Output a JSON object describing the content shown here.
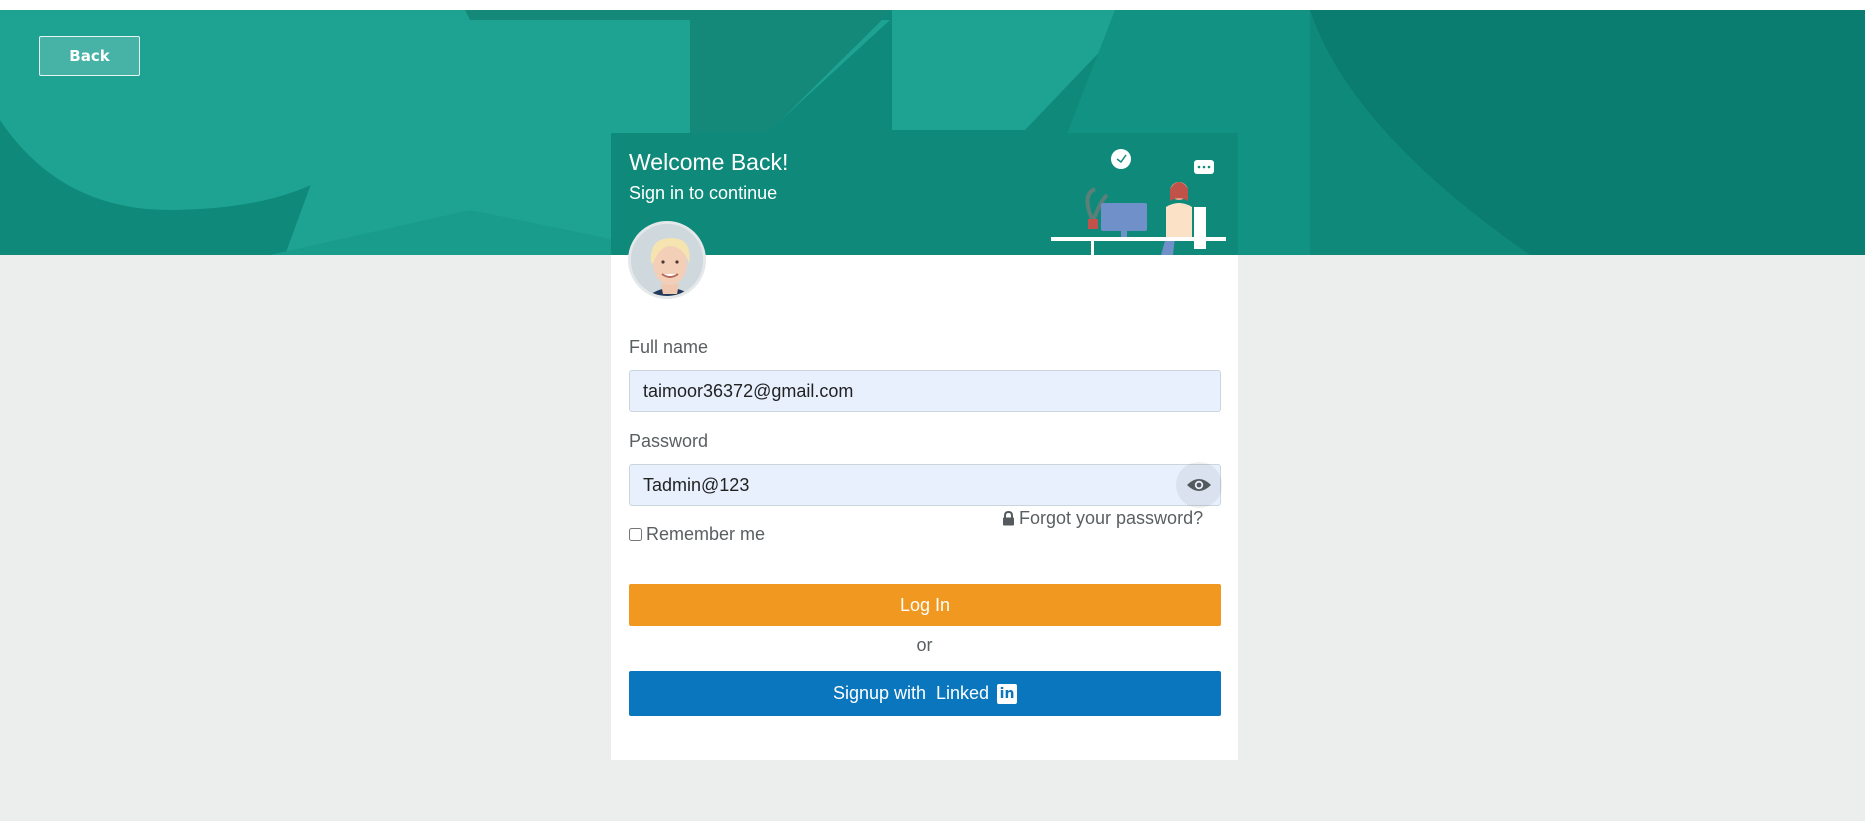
{
  "page": {
    "back_label": "Back"
  },
  "card": {
    "title": "Welcome Back!",
    "subtitle": "Sign in to continue"
  },
  "form": {
    "fullname_label": "Full name",
    "fullname_value": "taimoor36372@gmail.com",
    "password_label": "Password",
    "password_value": "Tadmin@123",
    "forgot_label": "Forgot your password?",
    "remember_label": "Remember me",
    "remember_checked": false,
    "login_label": "Log In",
    "or_label": "or",
    "linkedin_label": "Signup with  Linked",
    "linkedin_icon_text": "in"
  },
  "colors": {
    "teal": "#0f8a7a",
    "orange": "#f0981f",
    "linkedin_blue": "#0a76bd",
    "page_bg": "#eceeee"
  },
  "icons": [
    "eye-icon",
    "lock-icon",
    "linkedin-icon"
  ]
}
